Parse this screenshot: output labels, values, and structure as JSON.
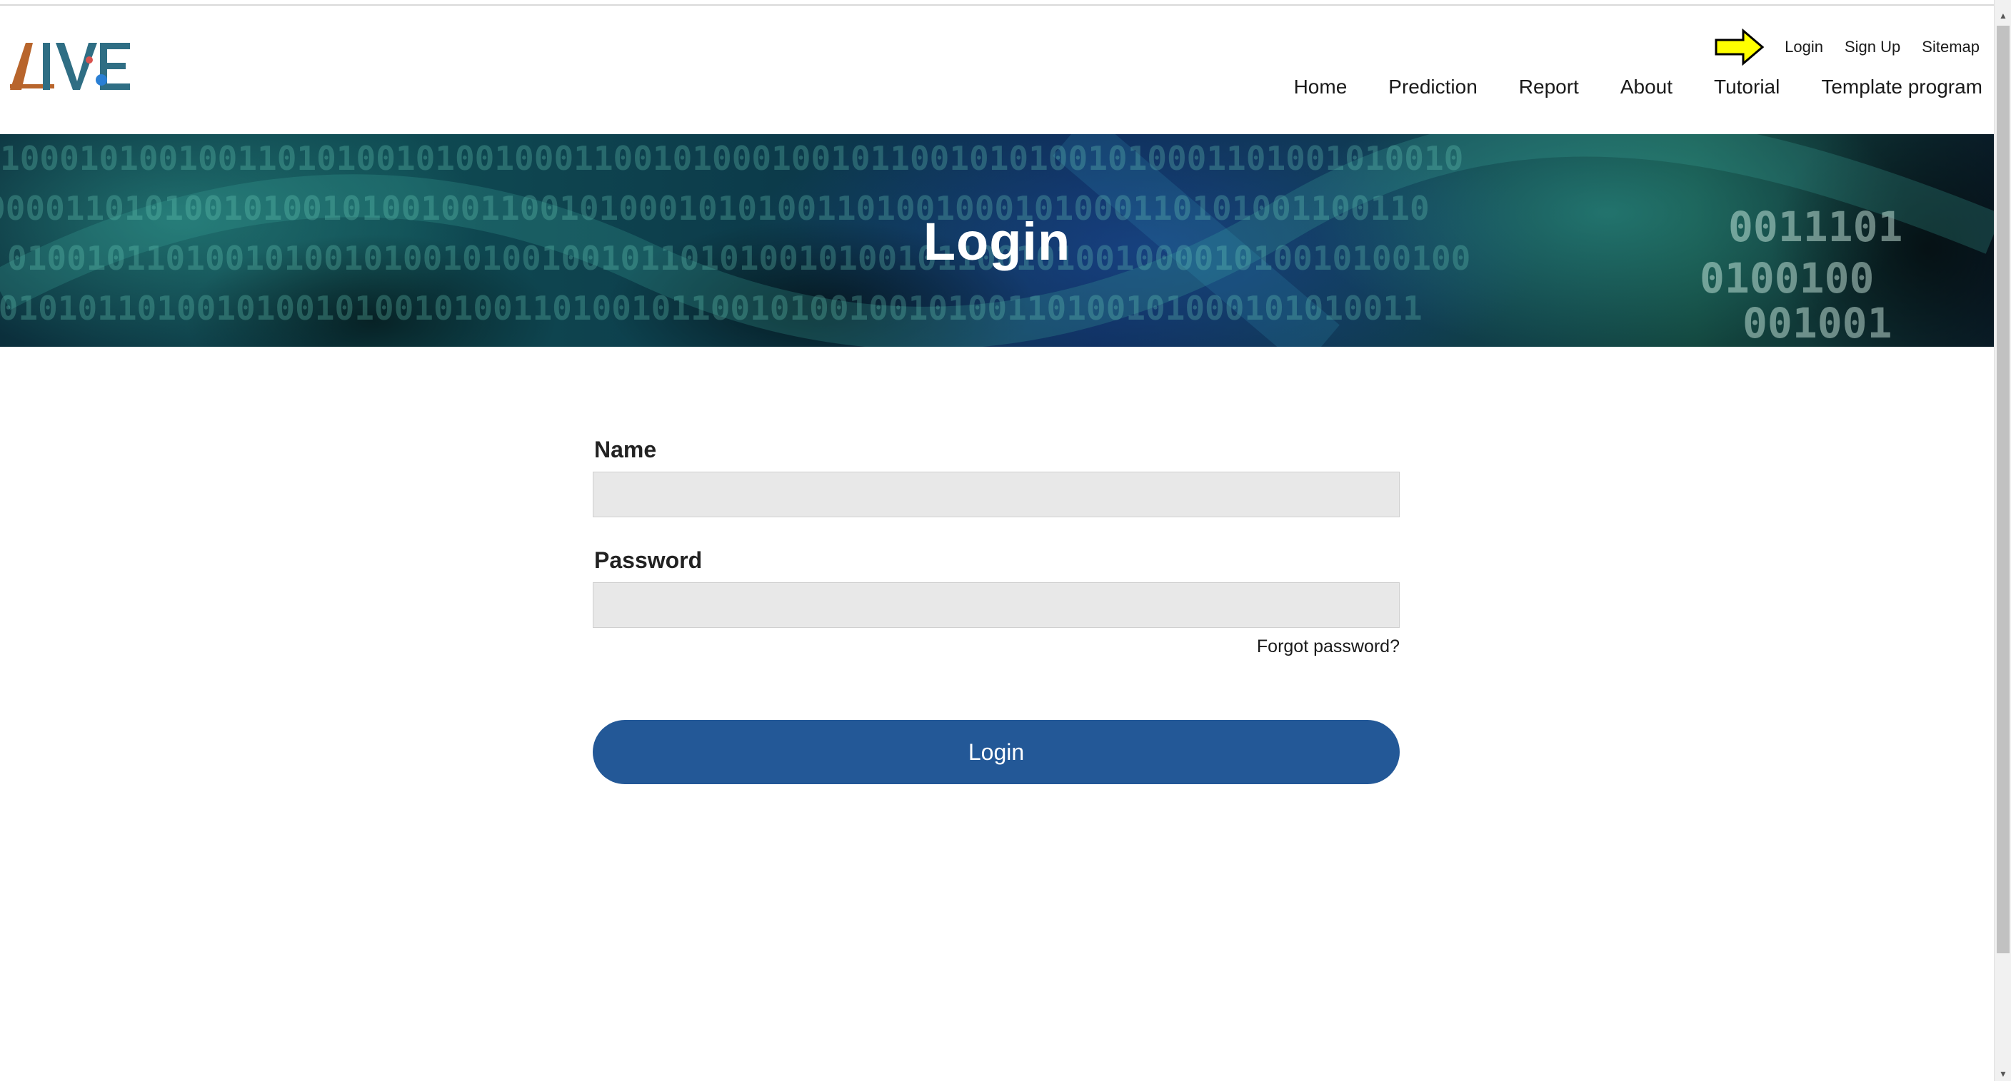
{
  "brand": {
    "logo_text": "AIVE"
  },
  "util_nav": {
    "items": [
      {
        "label": "Login"
      },
      {
        "label": "Sign Up"
      },
      {
        "label": "Sitemap"
      }
    ]
  },
  "main_nav": {
    "items": [
      {
        "label": "Home"
      },
      {
        "label": "Prediction"
      },
      {
        "label": "Report"
      },
      {
        "label": "About"
      },
      {
        "label": "Tutorial"
      },
      {
        "label": "Template program"
      }
    ]
  },
  "banner": {
    "title": "Login"
  },
  "form": {
    "name_label": "Name",
    "name_value": "",
    "password_label": "Password",
    "password_value": "",
    "forgot_label": "Forgot password?",
    "submit_label": "Login"
  },
  "colors": {
    "primary_button": "#235897",
    "input_bg": "#e8e8e8",
    "arrow_fill": "#ffff00"
  },
  "icons": {
    "arrow": "right-arrow-icon",
    "scroll_up": "chevron-up-icon",
    "scroll_down": "chevron-down-icon"
  }
}
